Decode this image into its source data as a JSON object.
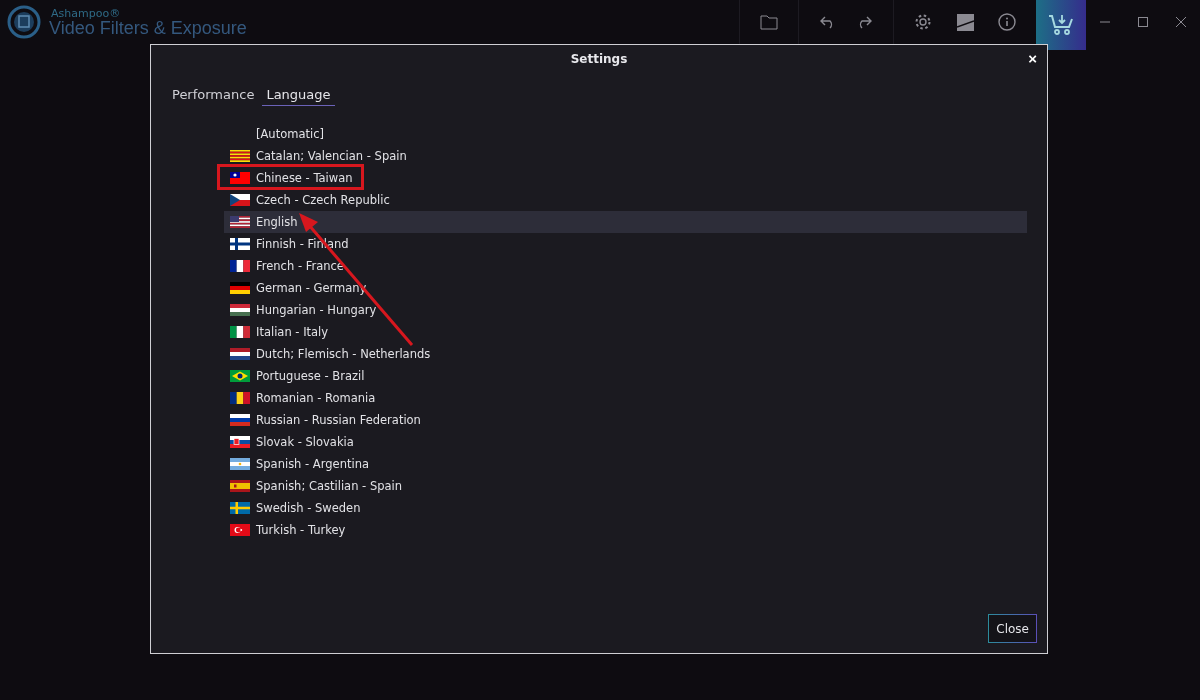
{
  "app": {
    "brand": "Ashampoo®",
    "title": "Video Filters & Exposure"
  },
  "dialog": {
    "title": "Settings",
    "close_glyph": "×",
    "tabs": [
      {
        "label": "Performance",
        "selected": false
      },
      {
        "label": "Language",
        "selected": true
      }
    ],
    "languages": [
      {
        "label": "[Automatic]",
        "selected": false
      },
      {
        "label": "Catalan; Valencian - Spain",
        "selected": false
      },
      {
        "label": "Chinese - Taiwan",
        "selected": false
      },
      {
        "label": "Czech - Czech Republic",
        "selected": false
      },
      {
        "label": "English",
        "selected": true
      },
      {
        "label": "Finnish - Finland",
        "selected": false
      },
      {
        "label": "French - France",
        "selected": false
      },
      {
        "label": "German - Germany",
        "selected": false
      },
      {
        "label": "Hungarian - Hungary",
        "selected": false
      },
      {
        "label": "Italian - Italy",
        "selected": false
      },
      {
        "label": "Dutch; Flemisch - Netherlands",
        "selected": false
      },
      {
        "label": "Portuguese - Brazil",
        "selected": false
      },
      {
        "label": "Romanian - Romania",
        "selected": false
      },
      {
        "label": "Russian - Russian Federation",
        "selected": false
      },
      {
        "label": "Slovak - Slovakia",
        "selected": false
      },
      {
        "label": "Spanish - Argentina",
        "selected": false
      },
      {
        "label": "Spanish; Castilian - Spain",
        "selected": false
      },
      {
        "label": "Swedish - Sweden",
        "selected": false
      },
      {
        "label": "Turkish - Turkey",
        "selected": false
      }
    ],
    "close_button": "Close"
  }
}
